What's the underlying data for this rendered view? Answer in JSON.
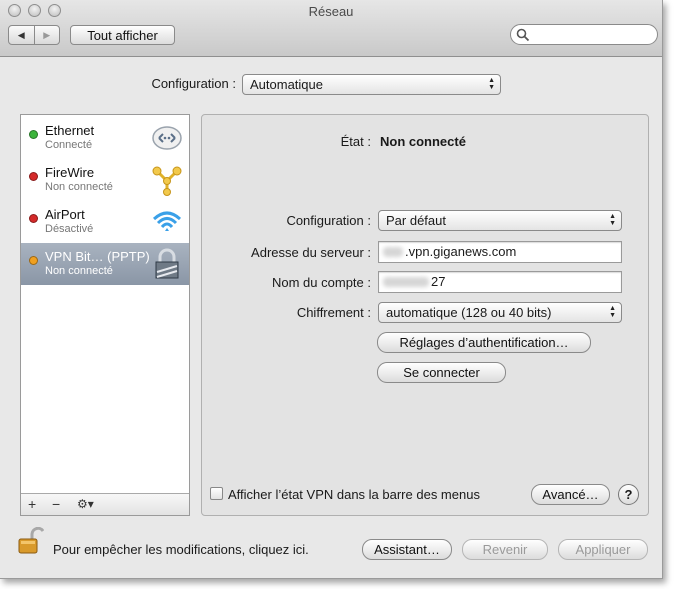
{
  "window": {
    "title": "Réseau"
  },
  "toolbar": {
    "show_all_label": "Tout afficher",
    "back_glyph": "◀",
    "forward_glyph": "▶",
    "search_placeholder": ""
  },
  "location": {
    "label": "Configuration :",
    "value": "Automatique"
  },
  "services": [
    {
      "name": "Ethernet",
      "status": "Connecté",
      "status_color": "#3cb43c",
      "icon": "ethernet-icon"
    },
    {
      "name": "FireWire",
      "status": "Non connecté",
      "status_color": "#d42a2a",
      "icon": "firewire-icon"
    },
    {
      "name": "AirPort",
      "status": "Désactivé",
      "status_color": "#d42a2a",
      "icon": "airport-wifi-icon"
    },
    {
      "name": "VPN Bit… (PPTP)",
      "status": "Non connecté",
      "status_color": "#f0a020",
      "icon": "vpn-lock-icon",
      "selected": true
    }
  ],
  "list_actions": {
    "add": "+",
    "remove": "−",
    "gear": "⚙▾"
  },
  "detail": {
    "state_label": "État :",
    "state_value": "Non connecté",
    "config_label": "Configuration :",
    "config_value": "Par défaut",
    "server_label": "Adresse du serveur :",
    "server_value": ".vpn.giganews.com",
    "account_label": "Nom du compte :",
    "account_value": "27",
    "encryption_label": "Chiffrement :",
    "encryption_value": "automatique (128 ou 40 bits)",
    "auth_button": "Réglages d’authentification…",
    "connect_button": "Se connecter",
    "show_vpn_label": "Afficher l’état VPN dans la barre des menus",
    "show_vpn_checked": false,
    "advanced_button": "Avancé…",
    "help_glyph": "?"
  },
  "footer": {
    "lock_text": "Pour empêcher les modifications, cliquez ici.",
    "assistant_button": "Assistant…",
    "revert_button": "Revenir",
    "apply_button": "Appliquer"
  }
}
